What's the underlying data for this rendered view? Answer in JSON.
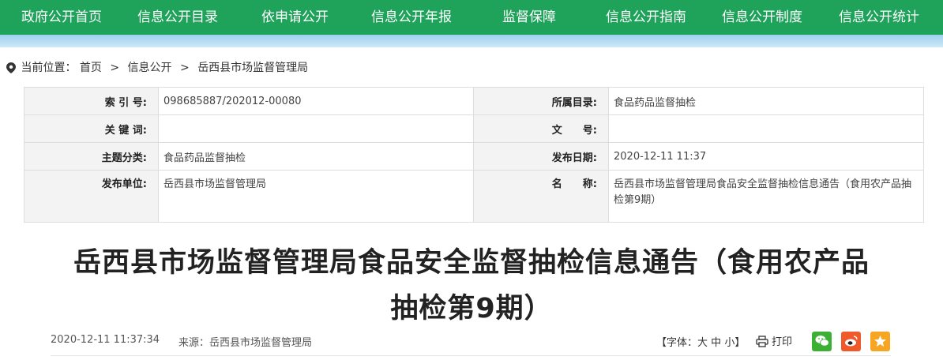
{
  "nav": {
    "items": [
      "政府公开首页",
      "信息公开目录",
      "依申请公开",
      "信息公开年报",
      "监督保障",
      "信息公开指南",
      "信息公开制度",
      "信息公开统计"
    ],
    "bg_color": "#1fa35a"
  },
  "breadcrumb": {
    "prefix": "当前位置：",
    "items": [
      "首页",
      "信息公开",
      "岳西县市场监督管理局"
    ],
    "separator": ">"
  },
  "meta": {
    "index_label": "索 引 号:",
    "index_value": "098685887/202012-00080",
    "catalog_label": "所属目录:",
    "catalog_value": "食品药品监督抽检",
    "keyword_label": "关 键 词:",
    "keyword_value": "",
    "docno_label": "文　　号:",
    "docno_value": "",
    "category_label": "主题分类:",
    "category_value": "食品药品监督抽检",
    "pubdate_label": "发布日期:",
    "pubdate_value": "2020-12-11 11:37",
    "publisher_label": "发布单位:",
    "publisher_value": "岳西县市场监督管理局",
    "name_label": "名　　称:",
    "name_value": "岳西县市场监督管理局食品安全监督抽检信息通告（食用农产品抽检第9期）"
  },
  "article": {
    "title_line1": "岳西县市场监督管理局食品安全监督抽检信息通告（食用农产品",
    "title_line2": "抽检第9期）",
    "date": "2020-12-11 11:37:34",
    "source": "来源：岳西县市场监督管理局",
    "font_open": "【字体：",
    "font_large": "大",
    "font_medium": "中",
    "font_small": "小",
    "font_close": "】",
    "print_label": "打印"
  },
  "share_icons": [
    "wechat-icon",
    "weibo-icon",
    "qzone-icon"
  ]
}
